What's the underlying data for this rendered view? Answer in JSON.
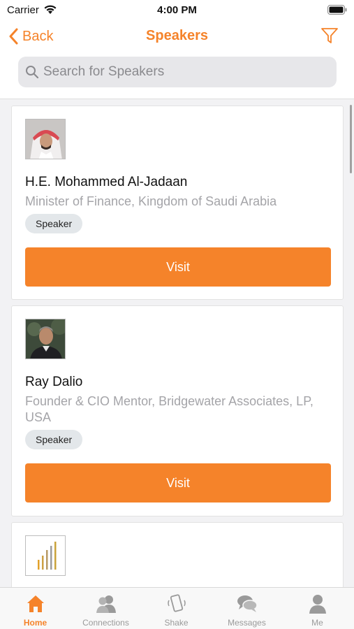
{
  "status_bar": {
    "carrier": "Carrier",
    "time": "4:00 PM"
  },
  "nav": {
    "back_label": "Back",
    "title": "Speakers"
  },
  "search": {
    "placeholder": "Search for Speakers",
    "value": ""
  },
  "speakers": [
    {
      "name": "H.E. Mohammed Al-Jadaan",
      "title": "Minister of Finance, Kingdom of Saudi Arabia",
      "badge": "Speaker",
      "action": "Visit",
      "photo": "portrait-man-headscarf"
    },
    {
      "name": "Ray Dalio",
      "title": "Founder & CIO Mentor, Bridgewater Associates, LP, USA",
      "badge": "Speaker",
      "action": "Visit",
      "photo": "portrait-man-outdoors"
    },
    {
      "photo": "bar-logo"
    }
  ],
  "tabs": [
    {
      "label": "Home",
      "icon": "home-icon",
      "active": true
    },
    {
      "label": "Connections",
      "icon": "connections-icon",
      "active": false
    },
    {
      "label": "Shake",
      "icon": "shake-icon",
      "active": false
    },
    {
      "label": "Messages",
      "icon": "messages-icon",
      "active": false
    },
    {
      "label": "Me",
      "icon": "person-icon",
      "active": false
    }
  ],
  "colors": {
    "accent": "#f5832a",
    "inactive": "#9a9a9a",
    "subtitle": "#a4a4a8"
  }
}
